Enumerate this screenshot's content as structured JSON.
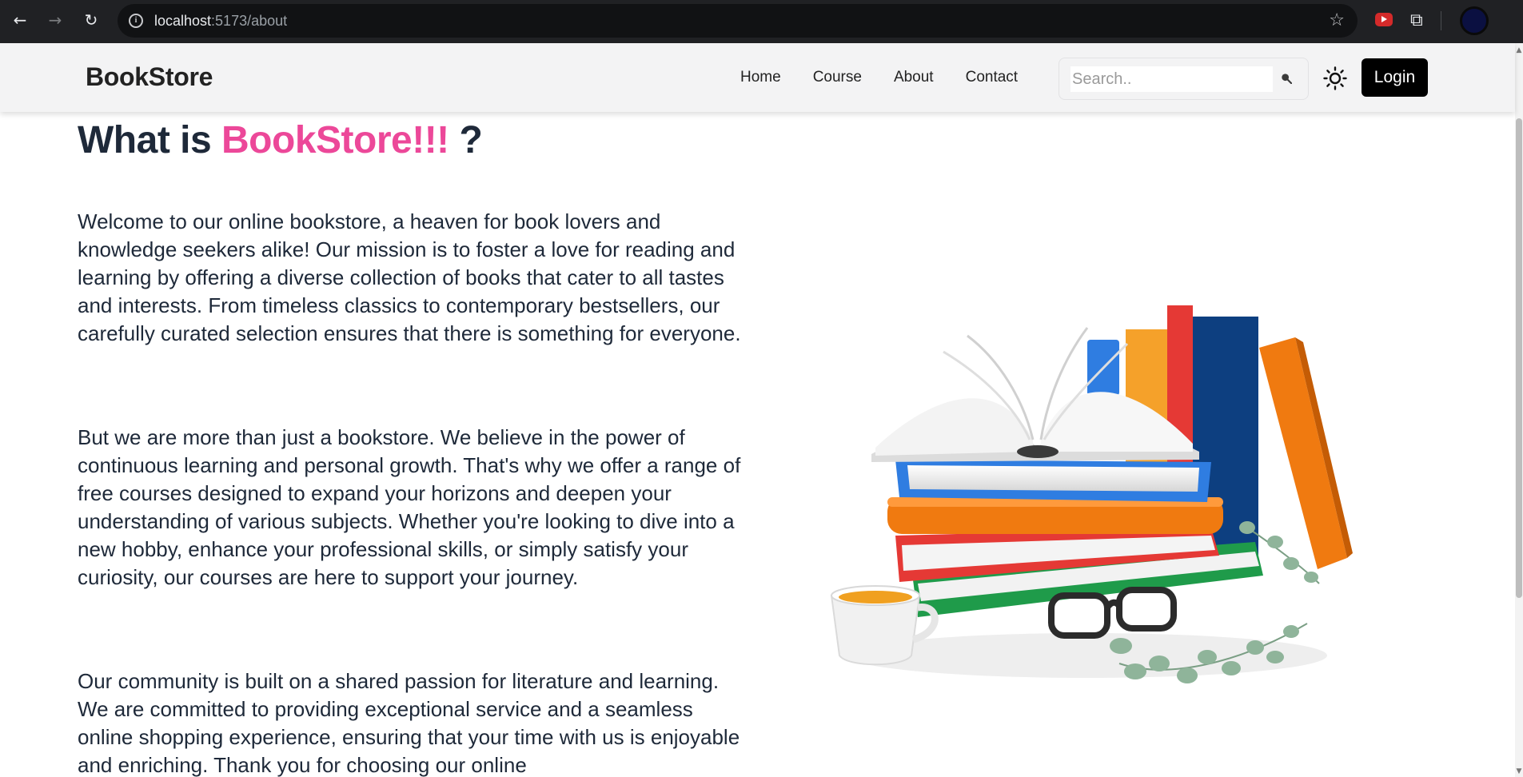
{
  "browser": {
    "url_host": "localhost",
    "url_path": ":5173/about"
  },
  "nav": {
    "logo": "BookStore",
    "links": [
      "Home",
      "Course",
      "About",
      "Contact"
    ],
    "search_placeholder": "Search..",
    "login_label": "Login"
  },
  "main": {
    "heading_prefix": "What is",
    "heading_brand": "BookStore!!!",
    "heading_suffix": "?",
    "paragraphs": [
      "Welcome to our online bookstore, a heaven for book lovers and knowledge seekers alike! Our mission is to foster a love for reading and learning by offering a diverse collection of books that cater to all tastes and interests. From timeless classics to contemporary bestsellers, our carefully curated selection ensures that there is something for everyone.",
      "But we are more than just a bookstore. We believe in the power of continuous learning and personal growth. That's why we offer a range of free courses designed to expand your horizons and deepen your understanding of various subjects. Whether you're looking to dive into a new hobby, enhance your professional skills, or simply satisfy your curiosity, our courses are here to support your journey.",
      "Our community is built on a shared passion for literature and learning. We are committed to providing exceptional service and a seamless online shopping experience, ensuring that your time with us is enjoyable and enriching. Thank you for choosing our online"
    ]
  },
  "colors": {
    "brand_pink": "#ec4899",
    "text_dark": "#1e2939",
    "nav_bg": "#f3f3f4",
    "login_bg": "#000000"
  }
}
